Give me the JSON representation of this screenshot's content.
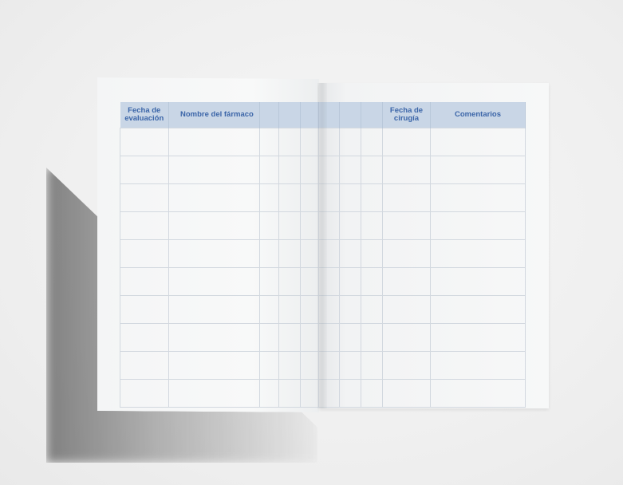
{
  "table": {
    "headers": {
      "eval_date_line1": "Fecha de",
      "eval_date_line2": "evaluación",
      "drug_name": "Nombre del fármaco",
      "surgery_date_line1": "Fecha de",
      "surgery_date_line2": "cirugía",
      "comments": "Comentarios"
    },
    "header_color": "#c9d6e6",
    "header_text_color": "#3b65a8",
    "row_count": 10,
    "column_count": 10
  }
}
